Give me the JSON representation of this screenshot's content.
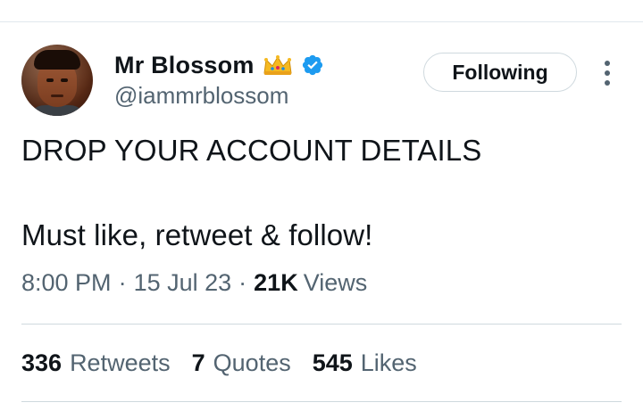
{
  "tweet": {
    "author": {
      "display_name": "Mr Blossom",
      "crown_emoji": "👑",
      "handle": "@iammrblossom",
      "verified": true
    },
    "follow_button_label": "Following",
    "text_lines": [
      "DROP YOUR ACCOUNT DETAILS",
      "Must like, retweet & follow!"
    ],
    "time": "8:00 PM",
    "separator": "·",
    "date": "15 Jul 23",
    "views_count": "21K",
    "views_label": "Views",
    "stats": [
      {
        "count": "336",
        "label": "Retweets"
      },
      {
        "count": "7",
        "label": "Quotes"
      },
      {
        "count": "545",
        "label": "Likes"
      }
    ]
  },
  "colors": {
    "text_primary": "#0f1419",
    "text_secondary": "#536471",
    "verified_blue": "#1d9bf0",
    "border": "#cfd9de"
  },
  "icons": [
    "crown-icon",
    "verified-badge-icon",
    "more-options-icon"
  ]
}
